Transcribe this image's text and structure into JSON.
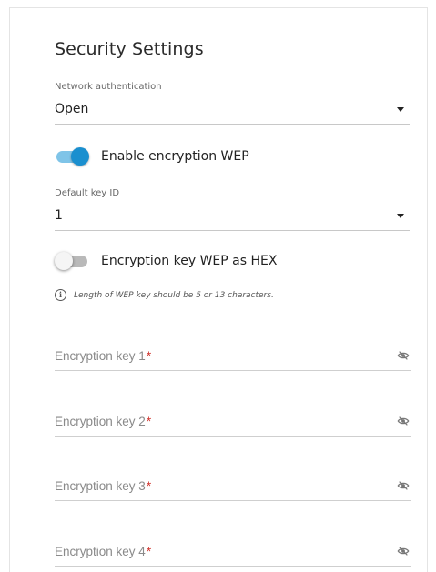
{
  "section": {
    "title": "Security Settings"
  },
  "network_auth": {
    "label": "Network authentication",
    "value": "Open"
  },
  "enable_wep": {
    "label": "Enable encryption WEP",
    "state": "on"
  },
  "default_key": {
    "label": "Default key ID",
    "value": "1"
  },
  "wep_hex": {
    "label": "Encryption key WEP as HEX",
    "state": "off"
  },
  "hint": {
    "icon": "i",
    "text": "Length of WEP key should be 5 or 13 characters."
  },
  "keys": [
    {
      "placeholder": "Encryption key 1",
      "required_mark": "*"
    },
    {
      "placeholder": "Encryption key 2",
      "required_mark": "*"
    },
    {
      "placeholder": "Encryption key 3",
      "required_mark": "*"
    },
    {
      "placeholder": "Encryption key 4",
      "required_mark": "*"
    }
  ],
  "colors": {
    "accent": "#1a8fcf",
    "required": "#d0322b"
  }
}
